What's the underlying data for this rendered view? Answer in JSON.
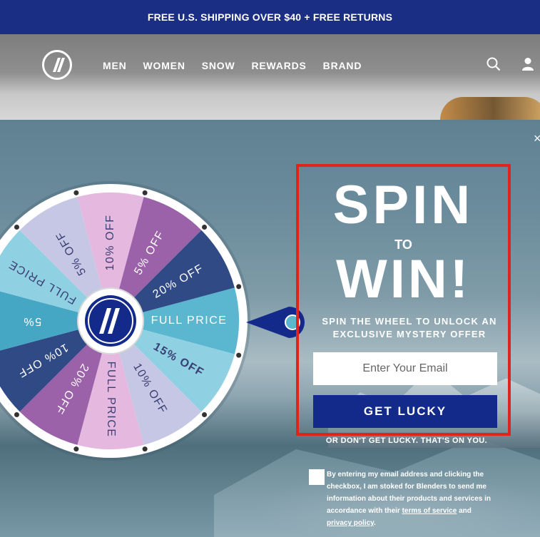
{
  "promo_bar": {
    "text": "FREE U.S. SHIPPING OVER $40 + FREE RETURNS"
  },
  "nav": {
    "items": [
      {
        "label": "MEN"
      },
      {
        "label": "WOMEN"
      },
      {
        "label": "SNOW"
      },
      {
        "label": "REWARDS"
      },
      {
        "label": "BRAND"
      }
    ],
    "icons": [
      "logo-icon",
      "search-icon",
      "user-icon"
    ]
  },
  "modal": {
    "close_label": "×",
    "wheel": {
      "segments": [
        {
          "label": "FULL PRICE",
          "color": "#5bb6cf"
        },
        {
          "label": "15% OFF",
          "color": "#8fd0e3"
        },
        {
          "label": "10% OFF",
          "color": "#c6c7e4"
        },
        {
          "label": "FULL PRICE",
          "color": "#e5b8df"
        },
        {
          "label": "20% OFF",
          "color": "#9b62a9"
        },
        {
          "label": "10% OFF",
          "color": "#2f4a85"
        },
        {
          "label": "5%",
          "color": "#45a7c4"
        },
        {
          "label": "FULL PRICE",
          "color": "#8fd0e3"
        },
        {
          "label": "5% OFF",
          "color": "#c6c7e4"
        },
        {
          "label": "10% OFF",
          "color": "#e5b8df"
        },
        {
          "label": "5% OFF",
          "color": "#9b62a9"
        },
        {
          "label": "20% OFF",
          "color": "#2f4a85"
        }
      ]
    },
    "headline_top": "SPIN",
    "headline_mid": "TO",
    "headline_bottom": "WIN!",
    "subheading": "SPIN THE WHEEL TO UNLOCK AN EXCLUSIVE MYSTERY OFFER",
    "email_placeholder": "Enter Your Email",
    "cta_label": "GET LUCKY",
    "decline_text": "OR DON'T GET LUCKY. THAT'S ON YOU.",
    "consent": {
      "text_before": "By entering my email address and clicking the checkbox, I am stoked for Blenders to send me information about their products and services in accordance with their",
      "terms_link": "terms of service",
      "and_text": "and",
      "privacy_link": "privacy policy",
      "period": "."
    },
    "colors": {
      "panel_border": "#e0231c",
      "cta_bg": "#132a8b",
      "promo_bg": "#1a2e83"
    }
  }
}
